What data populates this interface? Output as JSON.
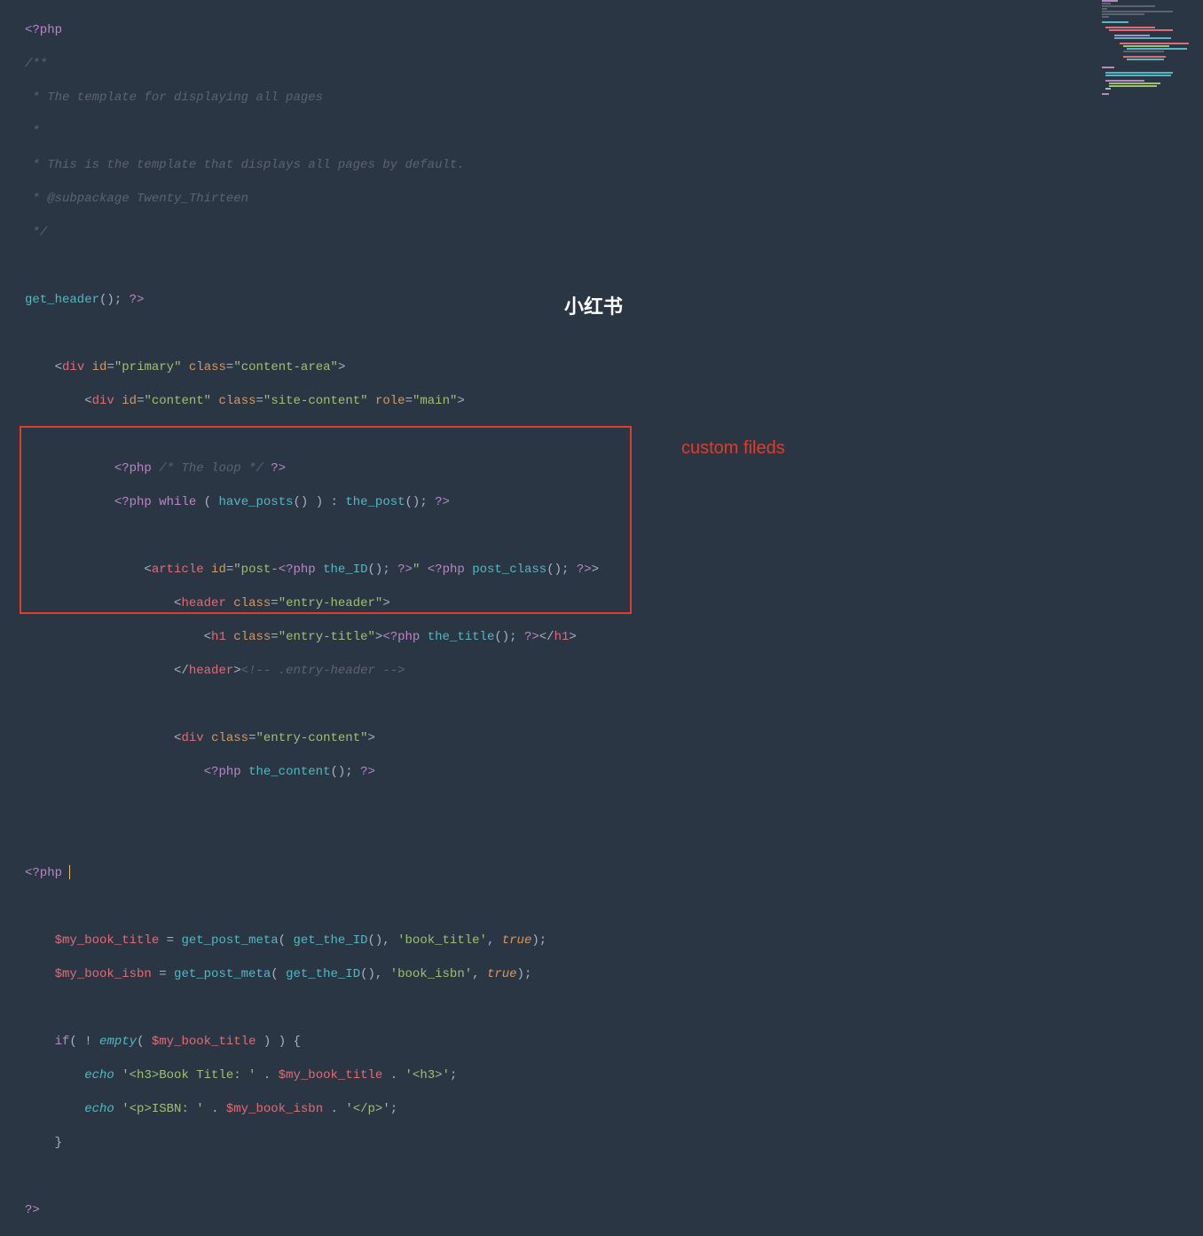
{
  "code": {
    "lines": [
      "<?php",
      "/**",
      " * The template for displaying all pages",
      " *",
      " * This is the template that displays all pages by default.",
      " * @subpackage Twenty_Thirteen",
      " */",
      "",
      "get_header(); ?>",
      "",
      "    <div id=\"primary\" class=\"content-area\">",
      "        <div id=\"content\" class=\"site-content\" role=\"main\">",
      "",
      "            <?php /* The loop */ ?>",
      "            <?php while ( have_posts() ) : the_post(); ?>",
      "",
      "                <article id=\"post-<?php the_ID(); ?>\" <?php post_class(); ?>>",
      "                    <header class=\"entry-header\">",
      "                        <h1 class=\"entry-title\"><?php the_title(); ?></h1>",
      "                    </header><!-- .entry-header -->",
      "",
      "                    <div class=\"entry-content\">",
      "                        <?php the_content(); ?>",
      "",
      "",
      "<?php ",
      "",
      "    $my_book_title = get_post_meta( get_the_ID(), 'book_title', true);",
      "    $my_book_isbn = get_post_meta( get_the_ID(), 'book_isbn', true);",
      "",
      "    if( ! empty( $my_book_title ) ) {",
      "        echo '<h3>Book Title: ' . $my_book_title . '<h3>';",
      "        echo '<p>ISBN: ' . $my_book_isbn . '</p>';",
      "    }",
      "",
      "?>"
    ]
  },
  "annotation": {
    "label": "custom fileds"
  },
  "watermark": {
    "text": "小红书"
  },
  "highlight": {
    "top_line": 26,
    "bottom_line": 36
  },
  "colors": {
    "background": "#2b3644",
    "highlight_border": "#e23b2a",
    "annotation_text": "#e23b2a"
  }
}
